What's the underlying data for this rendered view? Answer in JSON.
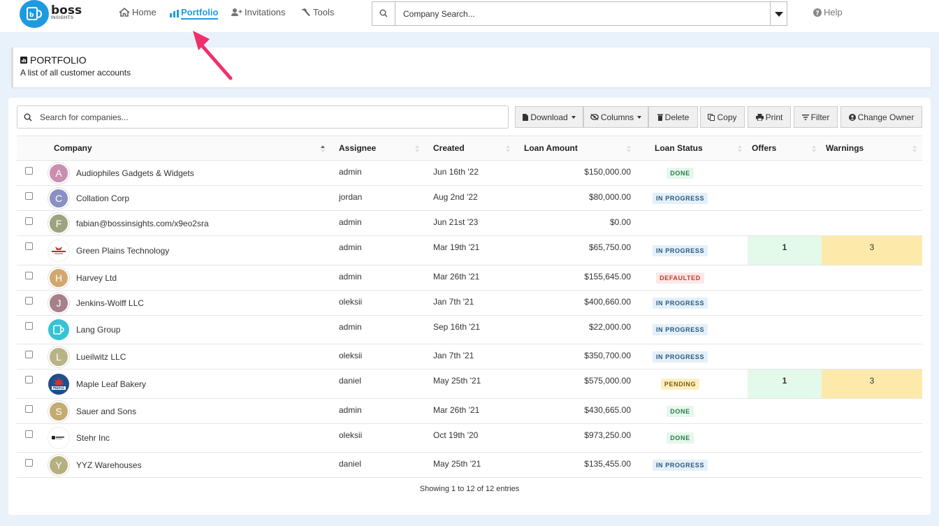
{
  "brand": {
    "name": "boss",
    "sub": "INSIGHTS",
    "color": "#1e9be0"
  },
  "nav": {
    "items": [
      {
        "label": "Home",
        "icon": "home-icon",
        "active": false
      },
      {
        "label": "Portfolio",
        "icon": "bar-chart-icon",
        "active": true
      },
      {
        "label": "Invitations",
        "icon": "user-plus-icon",
        "active": false
      },
      {
        "label": "Tools",
        "icon": "hammer-icon",
        "active": false
      }
    ],
    "company_search_placeholder": "Company Search...",
    "help_label": "Help"
  },
  "page": {
    "title": "PORTFOLIO",
    "subtitle": "A list of all customer accounts"
  },
  "toolbar": {
    "search_placeholder": "Search for companies...",
    "buttons": {
      "download": "Download",
      "columns": "Columns",
      "delete": "Delete",
      "copy": "Copy",
      "print": "Print",
      "filter": "Filter",
      "change_owner": "Change Owner"
    }
  },
  "table": {
    "columns": [
      "Company",
      "Assignee",
      "Created",
      "Loan Amount",
      "Loan Status",
      "Offers",
      "Warnings"
    ],
    "rows": [
      {
        "company": "Audiophiles Gadgets & Widgets",
        "avatar": "A",
        "avatar_color": "#c98fb0",
        "assignee": "admin",
        "created": "Jun 16th '22",
        "amount": "$150,000.00",
        "status": "DONE",
        "offers": "",
        "warnings": ""
      },
      {
        "company": "Collation Corp",
        "avatar": "C",
        "avatar_color": "#8a90c4",
        "assignee": "jordan",
        "created": "Aug 2nd '22",
        "amount": "$80,000.00",
        "status": "IN PROGRESS",
        "offers": "",
        "warnings": ""
      },
      {
        "company": "fabian@bossinsights.com/x9eo2sra",
        "avatar": "F",
        "avatar_color": "#9da37f",
        "assignee": "admin",
        "created": "Jun 21st '23",
        "amount": "$0.00",
        "status": "",
        "offers": "",
        "warnings": ""
      },
      {
        "company": "Green Plains Technology",
        "avatar": "",
        "avatar_color": "",
        "assignee": "admin",
        "created": "Mar 19th '21",
        "amount": "$65,750.00",
        "status": "IN PROGRESS",
        "offers": "1",
        "warnings": "3"
      },
      {
        "company": "Harvey Ltd",
        "avatar": "H",
        "avatar_color": "#d2a86e",
        "assignee": "admin",
        "created": "Mar 26th '21",
        "amount": "$155,645.00",
        "status": "DEFAULTED",
        "offers": "",
        "warnings": ""
      },
      {
        "company": "Jenkins-Wolff LLC",
        "avatar": "J",
        "avatar_color": "#a7808a",
        "assignee": "oleksii",
        "created": "Jan 7th '21",
        "amount": "$400,660.00",
        "status": "IN PROGRESS",
        "offers": "",
        "warnings": ""
      },
      {
        "company": "Lang Group",
        "avatar": "",
        "avatar_color": "",
        "assignee": "admin",
        "created": "Sep 16th '21",
        "amount": "$22,000.00",
        "status": "IN PROGRESS",
        "offers": "",
        "warnings": ""
      },
      {
        "company": "Lueilwitz LLC",
        "avatar": "L",
        "avatar_color": "#b9b487",
        "assignee": "oleksii",
        "created": "Jan 7th '21",
        "amount": "$350,700.00",
        "status": "IN PROGRESS",
        "offers": "",
        "warnings": ""
      },
      {
        "company": "Maple Leaf Bakery",
        "avatar": "",
        "avatar_color": "",
        "assignee": "daniel",
        "created": "May 25th '21",
        "amount": "$575,000.00",
        "status": "PENDING",
        "offers": "1",
        "warnings": "3"
      },
      {
        "company": "Sauer and Sons",
        "avatar": "S",
        "avatar_color": "#c4ab70",
        "assignee": "admin",
        "created": "Mar 26th '21",
        "amount": "$430,665.00",
        "status": "DONE",
        "offers": "",
        "warnings": ""
      },
      {
        "company": "Stehr Inc",
        "avatar": "",
        "avatar_color": "",
        "assignee": "oleksii",
        "created": "Oct 19th '20",
        "amount": "$973,250.00",
        "status": "DONE",
        "offers": "",
        "warnings": ""
      },
      {
        "company": "YYZ Warehouses",
        "avatar": "Y",
        "avatar_color": "#b5b07f",
        "assignee": "daniel",
        "created": "May 25th '21",
        "amount": "$135,455.00",
        "status": "IN PROGRESS",
        "offers": "",
        "warnings": ""
      }
    ],
    "footer": "Showing 1 to 12 of 12 entries"
  },
  "colors": {
    "done_bg": "#e6f7ec",
    "progress_bg": "#e3f0fa",
    "defaulted_bg": "#fde8e8",
    "pending_bg": "#fdf0c0",
    "offers_bg": "#e3f9ea",
    "warnings_bg": "#fdeaab",
    "arrow": "#f0306a"
  }
}
